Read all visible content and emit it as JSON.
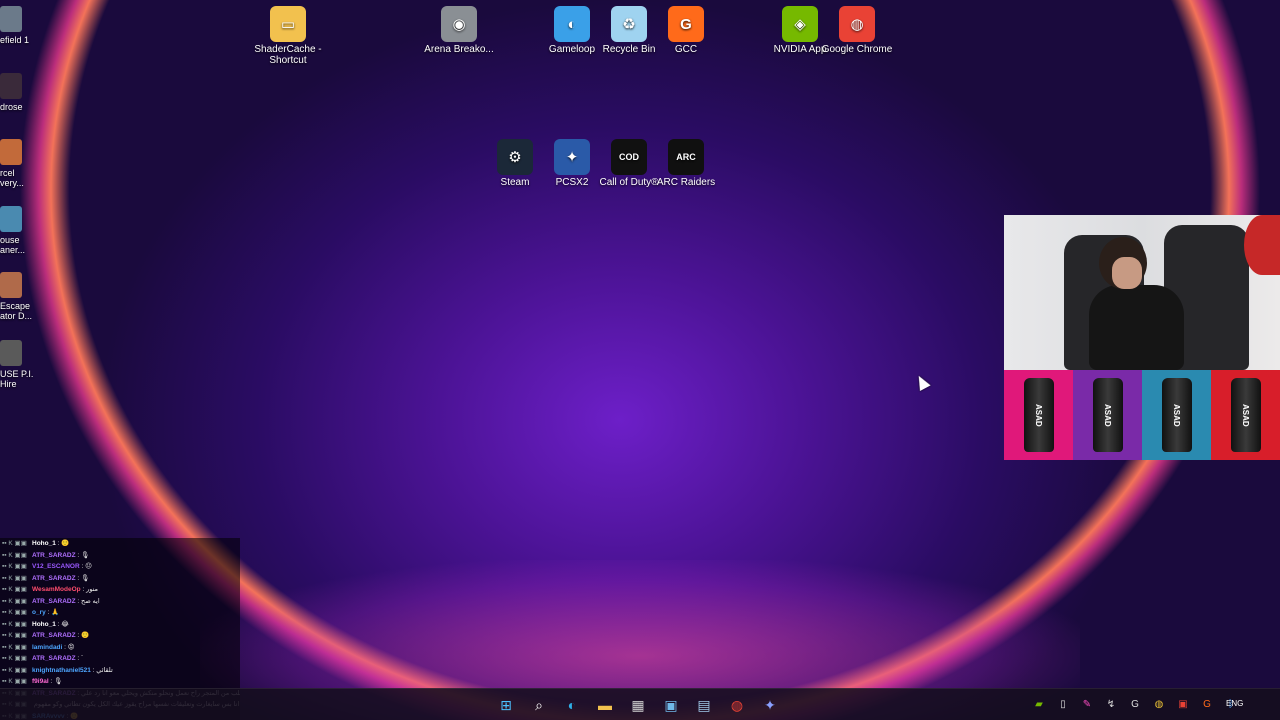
{
  "desktop": {
    "icons": [
      {
        "label": "ShaderCache - Shortcut",
        "icon": "folder-icon",
        "color": "#f2c14e",
        "glyph": "▭"
      },
      {
        "label": "Arena Breako...",
        "icon": "arena-breakout-icon",
        "color": "#8a8f94",
        "glyph": "◉"
      },
      {
        "label": "Gameloop",
        "icon": "gameloop-icon",
        "color": "#3aa0e8",
        "glyph": "◐"
      },
      {
        "label": "Recycle Bin",
        "icon": "recycle-bin-icon",
        "color": "#9fd3f0",
        "glyph": "♻"
      },
      {
        "label": "GCC",
        "icon": "gcc-icon",
        "color": "#ff6a1a",
        "glyph": "G"
      },
      {
        "label": "NVIDIA App",
        "icon": "nvidia-icon",
        "color": "#76b900",
        "glyph": "◈"
      },
      {
        "label": "Google Chrome",
        "icon": "chrome-icon",
        "color": "#e94235",
        "glyph": "◍"
      },
      {
        "label": "Steam",
        "icon": "steam-icon",
        "color": "#1b2838",
        "glyph": "⚙"
      },
      {
        "label": "PCSX2",
        "icon": "pcsx2-icon",
        "color": "#2a5aa8",
        "glyph": "✦"
      },
      {
        "label": "Call of Duty®",
        "icon": "call-of-duty-icon",
        "color": "#111111",
        "glyph": "COD"
      },
      {
        "label": "ARC Raiders",
        "icon": "arc-raiders-icon",
        "color": "#101010",
        "glyph": "ARC"
      }
    ],
    "edge_icons": [
      {
        "label": "efield 1",
        "icon": "battlefield-icon",
        "color": "#6b7a8a"
      },
      {
        "label": "drose",
        "icon": "game-icon",
        "color": "#3a2a3a"
      },
      {
        "label": "rcel very...",
        "icon": "game-icon",
        "color": "#c26a3a"
      },
      {
        "label": "ouse aner...",
        "icon": "game-icon",
        "color": "#4a8ab0"
      },
      {
        "label": "Escape ator D...",
        "icon": "game-icon",
        "color": "#b06a4a"
      },
      {
        "label": "USE P.I. Hire",
        "icon": "game-icon",
        "color": "#5a5a5a"
      }
    ]
  },
  "webcam": {
    "ad_cans": [
      {
        "label": "ASAD",
        "bg": "#e0187a"
      },
      {
        "label": "ASAD",
        "bg": "#7a2aa8"
      },
      {
        "label": "ASAD",
        "bg": "#2a8ab0"
      },
      {
        "label": "ASAD",
        "bg": "#d81e2a"
      }
    ]
  },
  "chat": {
    "messages": [
      {
        "user": "Hoho_1",
        "color": "#ffffff",
        "msg": ": 🙂"
      },
      {
        "user": "ATR_SARADZ",
        "color": "#b070ff",
        "msg": ": 🎙"
      },
      {
        "user": "V12_ESCANOR",
        "color": "#9b59ff",
        "msg": ": 😐"
      },
      {
        "user": "ATR_SARADZ",
        "color": "#b070ff",
        "msg": ": 🎙"
      },
      {
        "user": "WesamModeOp",
        "color": "#ff4d6d",
        "msg": ": منور"
      },
      {
        "user": "ATR_SARADZ",
        "color": "#b070ff",
        "msg": ": ايه صح"
      },
      {
        "user": "o_ry",
        "color": "#4da6ff",
        "msg": ": 🙏"
      },
      {
        "user": "Hoho_1",
        "color": "#ffffff",
        "msg": ": 😂"
      },
      {
        "user": "ATR_SARADZ",
        "color": "#b070ff",
        "msg": ": 🙂"
      },
      {
        "user": "lamindadi",
        "color": "#4da6ff",
        "msg": ": 😡"
      },
      {
        "user": "ATR_SARADZ",
        "color": "#b070ff",
        "msg": ": `"
      },
      {
        "user": "knightnathaniel521",
        "color": "#4da6ff",
        "msg": ": تلقائي"
      },
      {
        "user": "f9i9al",
        "color": "#ff6ad5",
        "msg": ": 🎙"
      },
      {
        "user": "ATR_SARADZ",
        "color": "#b070ff",
        "msg": ": اي حد حيطلب من المتجر راح نعمل ونحلو منكش ويحلي معو انا رد علي"
      },
      {
        "user": "",
        "color": "#ffffff",
        "msg": "ويشوف تعليقاتو انا بحل عادي يقوز انا بس سايغارت وتعليقات نفسها مراح يقوز عيك الكل يكون تطاتي وكو مفهوم"
      },
      {
        "user": "SARAvvvv",
        "color": "#4da6ff",
        "msg": ": 🙂"
      }
    ]
  },
  "taskbar": {
    "apps": [
      {
        "name": "start-button",
        "glyph": "⊞",
        "color": "#4cc2ff"
      },
      {
        "name": "search-button",
        "glyph": "⌕",
        "color": "#ffffff"
      },
      {
        "name": "edge-taskbar-button",
        "glyph": "◐",
        "color": "#2fb0e8"
      },
      {
        "name": "file-explorer-taskbar-button",
        "glyph": "▬",
        "color": "#f2c14e"
      },
      {
        "name": "store-taskbar-button",
        "glyph": "▦",
        "color": "#d0d0d0"
      },
      {
        "name": "photos-taskbar-button",
        "glyph": "▣",
        "color": "#6fb8e8"
      },
      {
        "name": "snipping-taskbar-button",
        "glyph": "▤",
        "color": "#9fc8e8"
      },
      {
        "name": "chrome-taskbar-button",
        "glyph": "◍",
        "color": "#e94235"
      },
      {
        "name": "pcsx2-taskbar-button",
        "glyph": "✦",
        "color": "#8aa0ff"
      }
    ],
    "tray": [
      {
        "name": "nvidia-tray-icon",
        "glyph": "▰",
        "color": "#76b900"
      },
      {
        "name": "usb-tray-icon",
        "glyph": "▯",
        "color": "#dddddd"
      },
      {
        "name": "brush-tray-icon",
        "glyph": "✎",
        "color": "#ff4dc4"
      },
      {
        "name": "app-tray-icon",
        "glyph": "↯",
        "color": "#dddddd"
      },
      {
        "name": "g-tray-icon",
        "glyph": "G",
        "color": "#dddddd"
      },
      {
        "name": "chrome-tray-icon",
        "glyph": "◍",
        "color": "#e9c135"
      },
      {
        "name": "red-tray-icon",
        "glyph": "▣",
        "color": "#e94235"
      },
      {
        "name": "gcc-tray-icon",
        "glyph": "G",
        "color": "#ff6a1a"
      },
      {
        "name": "bluetooth-tray-icon",
        "glyph": "ᛒ",
        "color": "#4da6ff"
      }
    ],
    "language": "ENG"
  }
}
